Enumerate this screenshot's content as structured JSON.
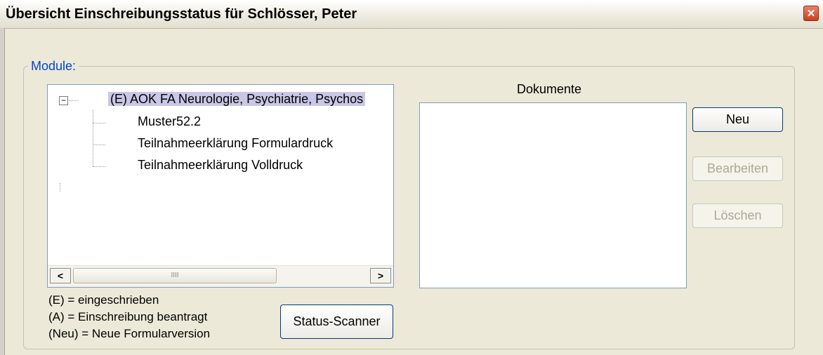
{
  "window": {
    "title": "Übersicht Einschreibungsstatus für Schlösser, Peter",
    "close_icon": "✕"
  },
  "group": {
    "label": "Module:"
  },
  "tree": {
    "expander": "−",
    "root": "(E) AOK FA Neurologie, Psychiatrie, Psychos",
    "children": [
      "Muster52.2",
      "Teilnahmeerklärung Formulardruck",
      "Teilnahmeerklärung Volldruck"
    ],
    "scroll_left": "<",
    "scroll_right": ">",
    "thumb_grip": "IIII"
  },
  "legend": [
    "(E)    = eingeschrieben",
    "(A)    = Einschreibung beantragt",
    "(Neu) = Neue Formularversion"
  ],
  "buttons": {
    "status_scanner": "Status-Scanner",
    "neu": "Neu",
    "bearbeiten": "Bearbeiten",
    "loeschen": "Löschen"
  },
  "documents": {
    "title": "Dokumente"
  }
}
